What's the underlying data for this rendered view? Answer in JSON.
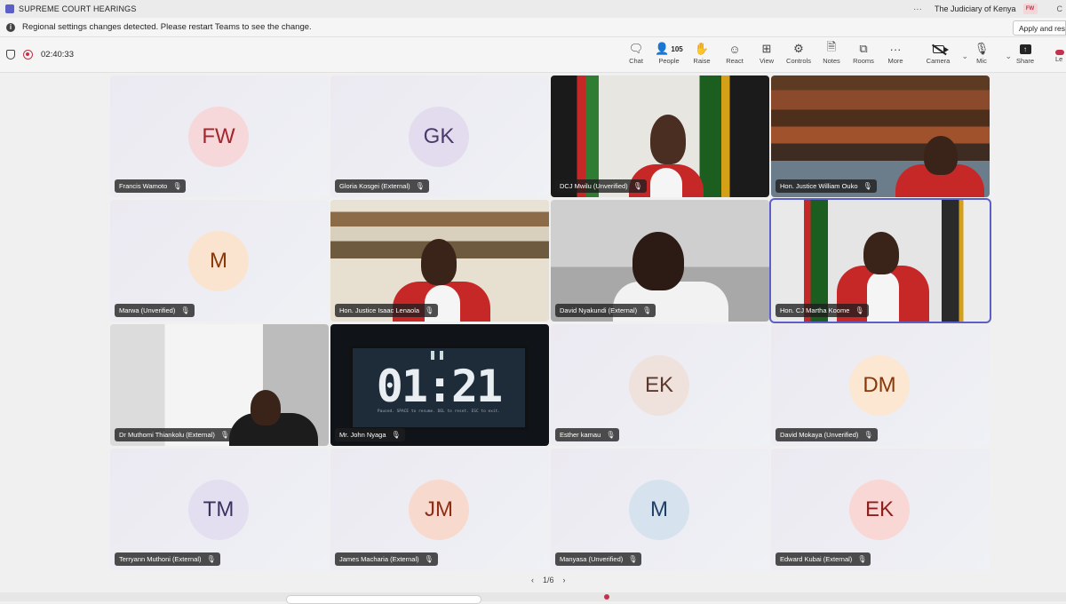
{
  "window": {
    "title": "SUPREME COURT HEARINGS",
    "more_icon": "more-horizontal-icon",
    "org_name": "The Judiciary of Kenya",
    "user_initials": "FW"
  },
  "banner": {
    "message": "Regional settings changes detected. Please restart Teams to see the change.",
    "apply_label": "Apply and resta"
  },
  "meeting": {
    "elapsed": "02:40:33"
  },
  "toolbar": {
    "chat": "Chat",
    "people": "People",
    "people_count": "105",
    "raise": "Raise",
    "react": "React",
    "view": "View",
    "controls": "Controls",
    "notes": "Notes",
    "rooms": "Rooms",
    "more": "More",
    "camera": "Camera",
    "mic": "Mic",
    "share": "Share",
    "leave": "Le"
  },
  "accent_color": "#5b5fc7",
  "tiles": [
    {
      "name": "Francis Wamoto",
      "initials": "FW",
      "avatar_bg": "#f6d8da",
      "avatar_fg": "#a4262c",
      "video": false
    },
    {
      "name": "Gloria Kosgei (External)",
      "initials": "GK",
      "avatar_bg": "#e3dcee",
      "avatar_fg": "#4a3b6b",
      "video": false
    },
    {
      "name": "DCJ Mwilu (Unverified)",
      "initials": "",
      "video": true
    },
    {
      "name": "Hon. Justice William Ouko",
      "initials": "",
      "video": true
    },
    {
      "name": "Marwa (Unverified)",
      "initials": "M",
      "avatar_bg": "#fbe4cf",
      "avatar_fg": "#8a3707",
      "video": false
    },
    {
      "name": "Hon. Justice Isaac Lenaola",
      "initials": "",
      "video": true
    },
    {
      "name": "David Nyakundi (External)",
      "initials": "",
      "video": true
    },
    {
      "name": "Hon. CJ Martha Koome",
      "initials": "",
      "video": true,
      "active": true
    },
    {
      "name": "Dr Muthomi Thiankolu (External)",
      "initials": "",
      "video": true
    },
    {
      "name": "Mr. John Nyaga",
      "initials": "",
      "video": true
    },
    {
      "name": "Esther kamau",
      "initials": "EK",
      "avatar_bg": "#efe1dc",
      "avatar_fg": "#5a3a2e",
      "video": false
    },
    {
      "name": "David Mokaya (Unverified)",
      "initials": "DM",
      "avatar_bg": "#fbe7d2",
      "avatar_fg": "#8a3707",
      "video": false
    },
    {
      "name": "Terryann Muthoni (External)",
      "initials": "TM",
      "avatar_bg": "#e4dff0",
      "avatar_fg": "#3b3160",
      "video": false
    },
    {
      "name": "James Macharia (External)",
      "initials": "JM",
      "avatar_bg": "#f8d9cd",
      "avatar_fg": "#8e2d13",
      "video": false
    },
    {
      "name": "Manyasa (Unverified)",
      "initials": "M",
      "avatar_bg": "#d6e3ef",
      "avatar_fg": "#1f3f66",
      "video": false
    },
    {
      "name": "Edward Kubai (External)",
      "initials": "EK",
      "avatar_bg": "#f8d7d4",
      "avatar_fg": "#8e1f1f",
      "video": false
    }
  ],
  "timer_screen": {
    "digits": "01:21",
    "hint": "Paused. SPACE to resume. DEL to reset. ESC to exit."
  },
  "pager": {
    "label": "1/6"
  }
}
